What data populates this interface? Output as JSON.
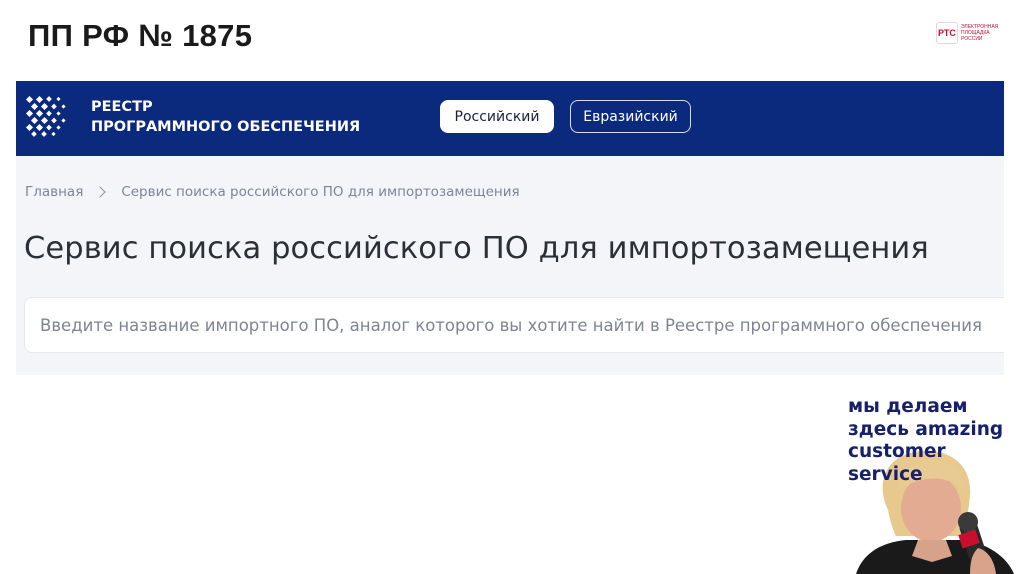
{
  "slide": {
    "title": "ПП РФ № 1875"
  },
  "logo": {
    "badge": "РТС",
    "lines": [
      "ЭЛЕКТРОННАЯ",
      "ПЛОЩАДКА",
      "РОССИИ"
    ]
  },
  "site": {
    "brand": {
      "line1": "РЕЕСТР",
      "line2": "ПРОГРАММНОГО ОБЕСПЕЧЕНИЯ"
    },
    "tabs": [
      {
        "label": "Российский",
        "active": true
      },
      {
        "label": "Евразийский",
        "active": false
      }
    ],
    "breadcrumb": {
      "home": "Главная",
      "current": "Сервис поиска российского ПО для импортозамещения"
    },
    "page_title": "Сервис поиска российского ПО для импортозамещения",
    "search": {
      "value": "",
      "placeholder": "Введите название импортного ПО, аналог которого вы хотите найти в Реестре программного обеспечения"
    }
  },
  "video": {
    "caption_lines": [
      "мы делаем",
      "здесь amazing",
      "customer",
      "service"
    ]
  },
  "colors": {
    "header_bg": "#0b2a7e",
    "page_bg": "#f4f5f8",
    "caption": "#16206b",
    "logo_red": "#c8102e"
  }
}
